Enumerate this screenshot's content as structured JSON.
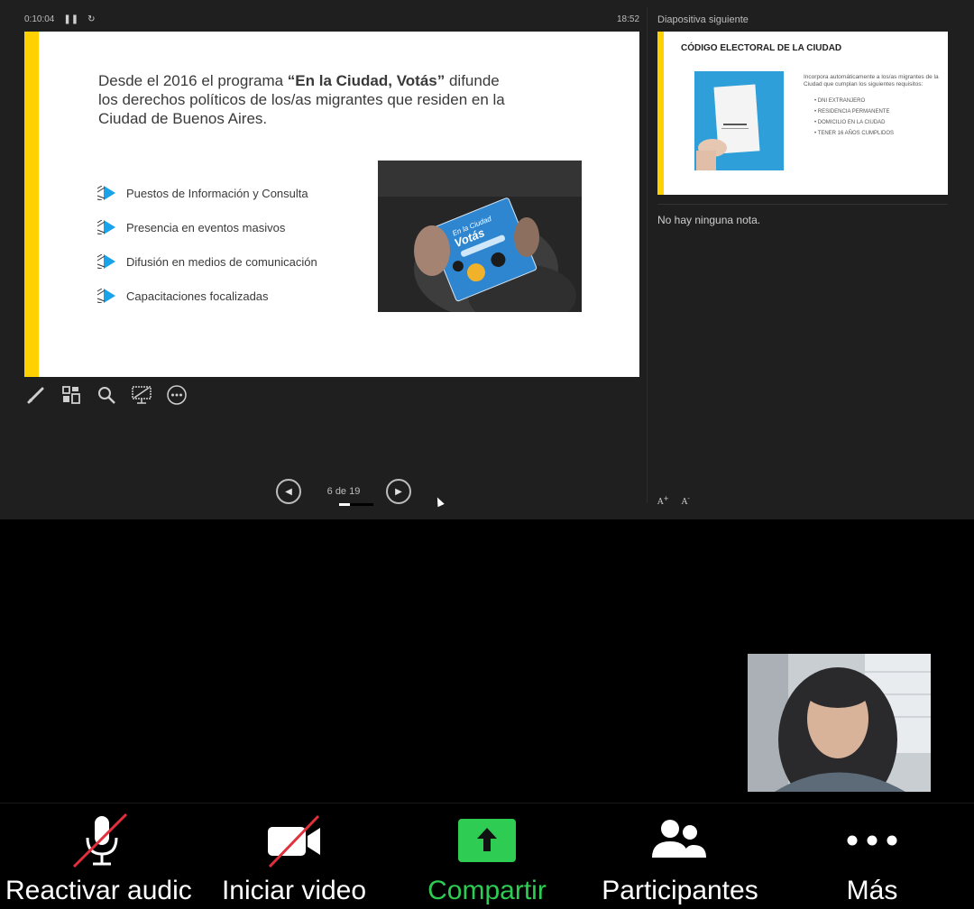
{
  "presenter": {
    "elapsed": "0:10:04",
    "clock": "18:52",
    "next_label": "Diapositiva siguiente",
    "notes": "No hay ninguna nota.",
    "slide_counter": "6 de 19",
    "progress_fraction": 0.32
  },
  "slide": {
    "title_pre": "Desde el 2016 el programa ",
    "title_bold": "“En la Ciudad, Votás”",
    "title_post": " difunde los derechos políticos de los/as migrantes que residen en la Ciudad de Buenos Aires.",
    "bullets": [
      "Puestos de Información y Consulta",
      "Presencia en eventos masivos",
      "Difusión en medios de comunicación",
      "Capacitaciones focalizadas"
    ],
    "photo_text_1": "En la Ciudad",
    "photo_text_2": "Votás"
  },
  "next_slide": {
    "title": "CÓDIGO ELECTORAL DE LA CIUDAD",
    "intro": "Incorpora automáticamente a los/as migrantes de la Ciudad que cumplan los siguientes requisitos:",
    "items": [
      "DNI EXTRANJERO",
      "RESIDENCIA PERMANENTE",
      "DOMICILIO EN LA CIUDAD",
      "TENER 16 AÑOS CUMPLIDOS"
    ]
  },
  "toolbar": {
    "mute": "Reactivar audic",
    "video": "Iniciar video",
    "share": "Compartir",
    "participants": "Participantes",
    "more": "Más"
  },
  "colors": {
    "accent_yellow": "#ffd100",
    "share_green": "#2ecc53",
    "mute_red": "#e0303b",
    "bullet_blue": "#1aa3e8"
  },
  "icons": {
    "pen": "pen-icon",
    "grid": "slides-grid-icon",
    "zoom": "zoom-icon",
    "screen": "black-screen-icon",
    "more": "more-options-icon"
  }
}
